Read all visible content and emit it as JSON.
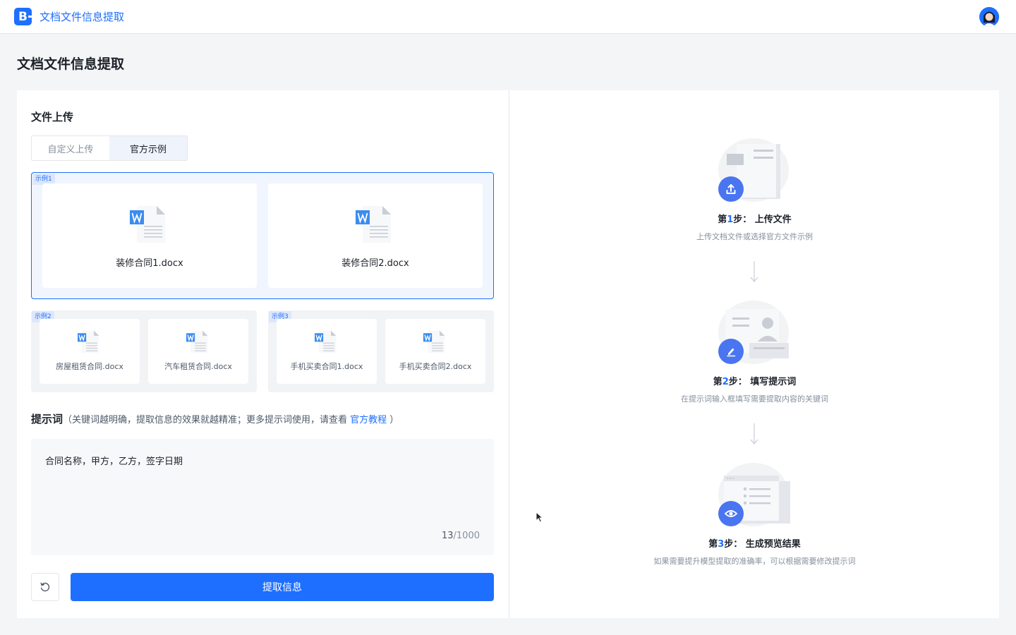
{
  "header": {
    "logo_letter": "B",
    "app_title": "文档文件信息提取"
  },
  "page": {
    "title": "文档文件信息提取"
  },
  "upload": {
    "section_title": "文件上传",
    "tabs": [
      {
        "label": "自定义上传",
        "active": false
      },
      {
        "label": "官方示例",
        "active": true
      }
    ],
    "examples": [
      {
        "tag": "示例1",
        "selected": true,
        "files": [
          "装修合同1.docx",
          "装修合同2.docx"
        ]
      },
      {
        "tag": "示例2",
        "selected": false,
        "files": [
          "房屋租赁合同.docx",
          "汽车租赁合同.docx"
        ]
      },
      {
        "tag": "示例3",
        "selected": false,
        "files": [
          "手机买卖合同1.docx",
          "手机买卖合同2.docx"
        ]
      }
    ]
  },
  "prompt": {
    "label": "提示词",
    "hint_prefix": "（关键词越明确，提取信息的效果就越精准；更多提示词使用，请查看 ",
    "hint_link": "官方教程",
    "hint_suffix": " ）",
    "value": "合同名称，甲方，乙方，签字日期",
    "count": "13",
    "max": "/1000"
  },
  "actions": {
    "submit_label": "提取信息",
    "reset_icon": "refresh-icon"
  },
  "steps": [
    {
      "prefix": "第",
      "num": "1",
      "suffix": "步：  上传文件",
      "desc": "上传文档文件或选择官方文件示例",
      "icon": "upload-icon"
    },
    {
      "prefix": "第",
      "num": "2",
      "suffix": "步：  填写提示词",
      "desc": "在提示词输入框填写需要提取内容的关键词",
      "icon": "pen-icon"
    },
    {
      "prefix": "第",
      "num": "3",
      "suffix": "步：  生成预览结果",
      "desc": "如果需要提升模型提取的准确率，可以根据需要修改提示词",
      "icon": "eye-icon"
    }
  ],
  "colors": {
    "primary": "#1e6fff",
    "badge": "#4a75f0",
    "word_icon": "#3b8cf0"
  }
}
